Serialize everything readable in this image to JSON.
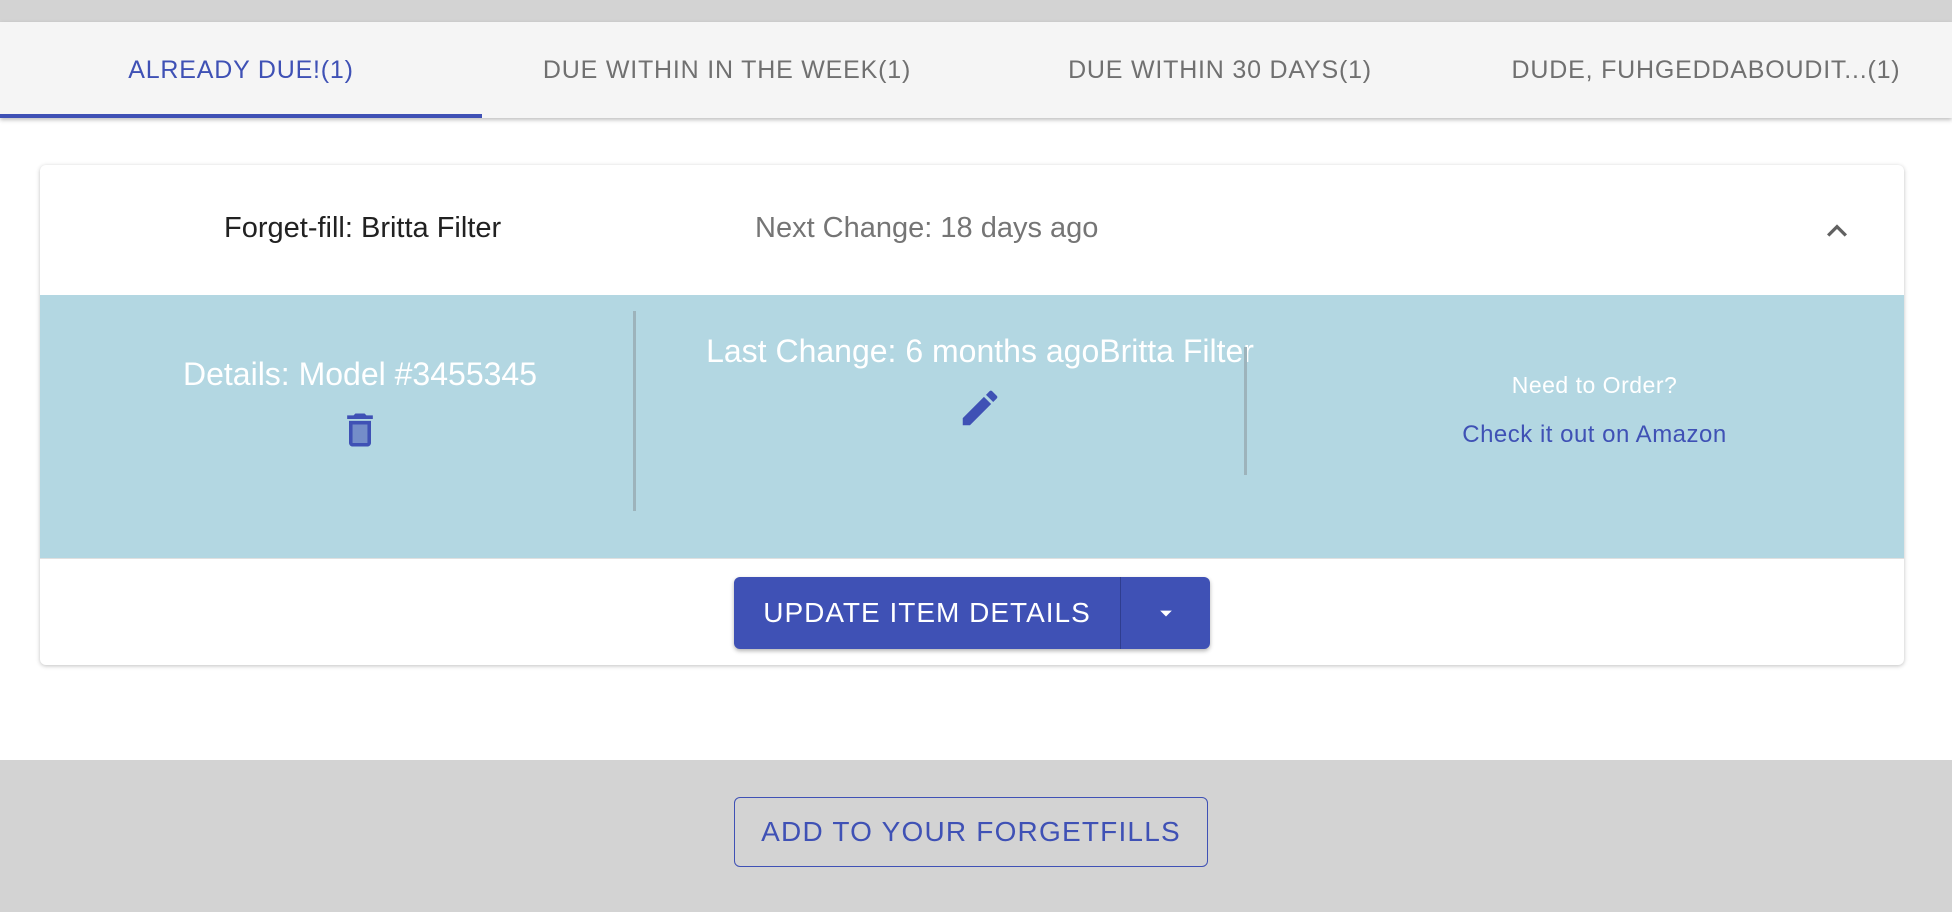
{
  "tabs": [
    {
      "label": "ALREADY DUE!(1)",
      "active": true
    },
    {
      "label": "DUE WITHIN IN THE WEEK(1)",
      "active": false
    },
    {
      "label": "DUE WITHIN 30 DAYS(1)",
      "active": false
    },
    {
      "label": "DUDE, FUHGEDDABOUDIT...(1)",
      "active": false
    }
  ],
  "item": {
    "title": "Forget-fill: Britta Filter",
    "next_change": "Next Change: 18 days ago",
    "details": "Details: Model #3455345",
    "last_change": "Last Change: 6 months agoBritta Filter",
    "need_to_order": "Need to Order?",
    "amazon_link": "Check it out on Amazon"
  },
  "actions": {
    "update_label": "UPDATE ITEM DETAILS",
    "add_label": "ADD TO YOUR FORGETFILLS"
  },
  "icons": {
    "collapse": "chevron-up-icon",
    "delete": "trash-icon",
    "edit": "pencil-icon",
    "dropdown": "caret-down-icon"
  },
  "colors": {
    "primary": "#3f51b5",
    "details_bg": "#b3d7e2",
    "tabbar_bg": "#f5f5f5",
    "bottom_bg": "#d3d3d3"
  }
}
